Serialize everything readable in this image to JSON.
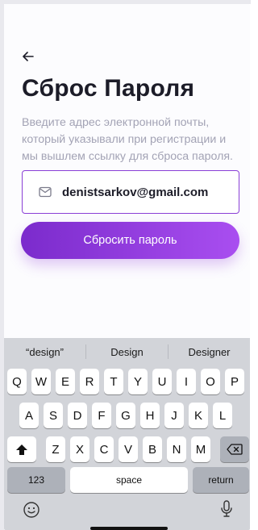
{
  "screen": {
    "title": "Сброс Пароля",
    "subtitle": "Введите адрес электронной почты, который указывали при регистрации и мы вышлем ссылку для сброса пароля."
  },
  "email_field": {
    "value": "denistsarkov@gmail.com",
    "icon": "mail-icon"
  },
  "reset_button": {
    "label": "Сбросить пароль"
  },
  "colors": {
    "accent_start": "#7b2bcc",
    "accent_end": "#a94ef0",
    "title": "#1c1c28",
    "subtitle": "#a3a3b5"
  },
  "keyboard": {
    "suggestions": [
      "“design”",
      "Design",
      "Designer"
    ],
    "row1": [
      "Q",
      "W",
      "E",
      "R",
      "T",
      "Y",
      "U",
      "I",
      "O",
      "P"
    ],
    "row2": [
      "A",
      "S",
      "D",
      "F",
      "G",
      "H",
      "J",
      "K",
      "L"
    ],
    "row3": [
      "Z",
      "X",
      "C",
      "V",
      "B",
      "N",
      "M"
    ],
    "numbers_label": "123",
    "space_label": "space",
    "return_label": "return"
  }
}
